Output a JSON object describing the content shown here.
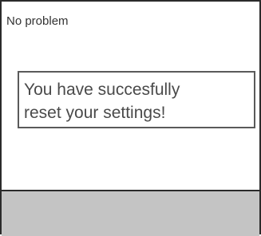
{
  "dialog": {
    "title": "No problem",
    "message_line1": "You have succesfully",
    "message_line2": "reset your settings!"
  },
  "colors": {
    "border": "#2b2b2b",
    "footer_background": "#c4c4c4",
    "message_text": "#4a4a4a"
  }
}
